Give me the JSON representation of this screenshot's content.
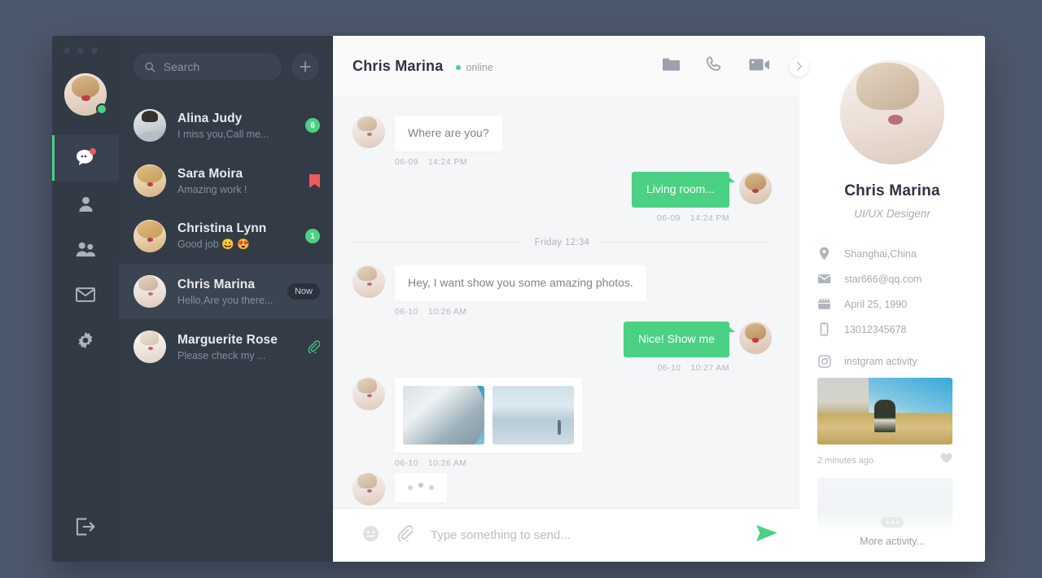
{
  "window": {
    "controls": [
      "close",
      "minimize",
      "maximize"
    ]
  },
  "colors": {
    "page_background": "#4c586c",
    "rail_background": "#323a46",
    "conv_background": "#333b47",
    "accent_green": "#4ad184",
    "badge_red": "#f05a5a",
    "chat_background": "#f5f6f7"
  },
  "rail": {
    "me_status": "online",
    "items": [
      {
        "id": "chats",
        "icon": "chat-bubble-icon",
        "active": true,
        "has_dot": true
      },
      {
        "id": "contacts",
        "icon": "person-icon",
        "active": false,
        "has_dot": false
      },
      {
        "id": "groups",
        "icon": "people-group-icon",
        "active": false,
        "has_dot": false
      },
      {
        "id": "mail",
        "icon": "envelope-icon",
        "active": false,
        "has_dot": false
      },
      {
        "id": "settings",
        "icon": "gear-icon",
        "active": false,
        "has_dot": false
      }
    ],
    "logout": {
      "id": "logout",
      "icon": "logout-icon"
    }
  },
  "search": {
    "placeholder": "Search",
    "value": "",
    "icon": "search-icon",
    "add_label": "+"
  },
  "conversations": [
    {
      "name": "Alina Judy",
      "preview": "I miss you,Call me...",
      "meta_type": "count",
      "meta": "6",
      "active": false,
      "avatar": "av-b"
    },
    {
      "name": "Sara Moira",
      "preview": "Amazing work !",
      "meta_type": "flag",
      "meta": "",
      "active": false,
      "avatar": "av-c"
    },
    {
      "name": "Christina Lynn",
      "preview": "Good  job  😀 😍",
      "meta_type": "count",
      "meta": "1",
      "active": false,
      "avatar": "av-c"
    },
    {
      "name": "Chris Marina",
      "preview": "Hello,Are you there...",
      "meta_type": "now",
      "meta": "Now",
      "active": true,
      "avatar": "av-d"
    },
    {
      "name": "Marguerite Rose",
      "preview": "Please check my ...",
      "meta_type": "clip",
      "meta": "",
      "active": false,
      "avatar": "av-e"
    }
  ],
  "chat_header": {
    "title": "Chris Marina",
    "status": "online",
    "actions": [
      {
        "id": "folder",
        "icon": "folder-icon"
      },
      {
        "id": "call",
        "icon": "phone-icon"
      },
      {
        "id": "video",
        "icon": "video-camera-icon"
      }
    ],
    "expand": {
      "icon": "chevron-right-icon"
    }
  },
  "messages": [
    {
      "kind": "text",
      "side": "in",
      "text": "Where are you?",
      "date": "06-09",
      "time": "14:24 PM",
      "avatar": "av-d"
    },
    {
      "kind": "text",
      "side": "out",
      "text": "Living room...",
      "date": "06-09",
      "time": "14:24 PM",
      "avatar": "av-a"
    },
    {
      "kind": "divider",
      "label": "Friday 12:34"
    },
    {
      "kind": "text",
      "side": "in",
      "text": "Hey,  I want show you some amazing photos.",
      "date": "06-10",
      "time": "10:26 AM",
      "avatar": "av-d"
    },
    {
      "kind": "text",
      "side": "out",
      "text": "Nice! Show me",
      "date": "06-10",
      "time": "10:27 AM",
      "avatar": "av-a"
    },
    {
      "kind": "photos",
      "side": "in",
      "photos": [
        "building-photo",
        "seascape-photo"
      ],
      "date": "06-10",
      "time": "10:26 AM",
      "avatar": "av-d"
    },
    {
      "kind": "typing",
      "side": "in",
      "avatar": "av-d"
    }
  ],
  "composer": {
    "placeholder": "Type something to send...",
    "value": "",
    "emoji_icon": "emoji-icon",
    "attach_icon": "paperclip-icon",
    "send_icon": "send-icon"
  },
  "profile": {
    "name": "Chris Marina",
    "role": "UI/UX Desigenr",
    "details": [
      {
        "icon": "location-pin-icon",
        "text": "Shanghai,China"
      },
      {
        "icon": "envelope-icon",
        "text": "star666@qq.com"
      },
      {
        "icon": "calendar-icon",
        "text": "April 25,  1990"
      },
      {
        "icon": "mobile-phone-icon",
        "text": "13012345678"
      }
    ],
    "activity": {
      "icon": "instagram-icon",
      "label": "instgram activity",
      "post_time": "2 minutes ago",
      "like_icon": "heart-icon",
      "more_label": "More activity...",
      "more_icon": "ellipsis-icon"
    }
  }
}
